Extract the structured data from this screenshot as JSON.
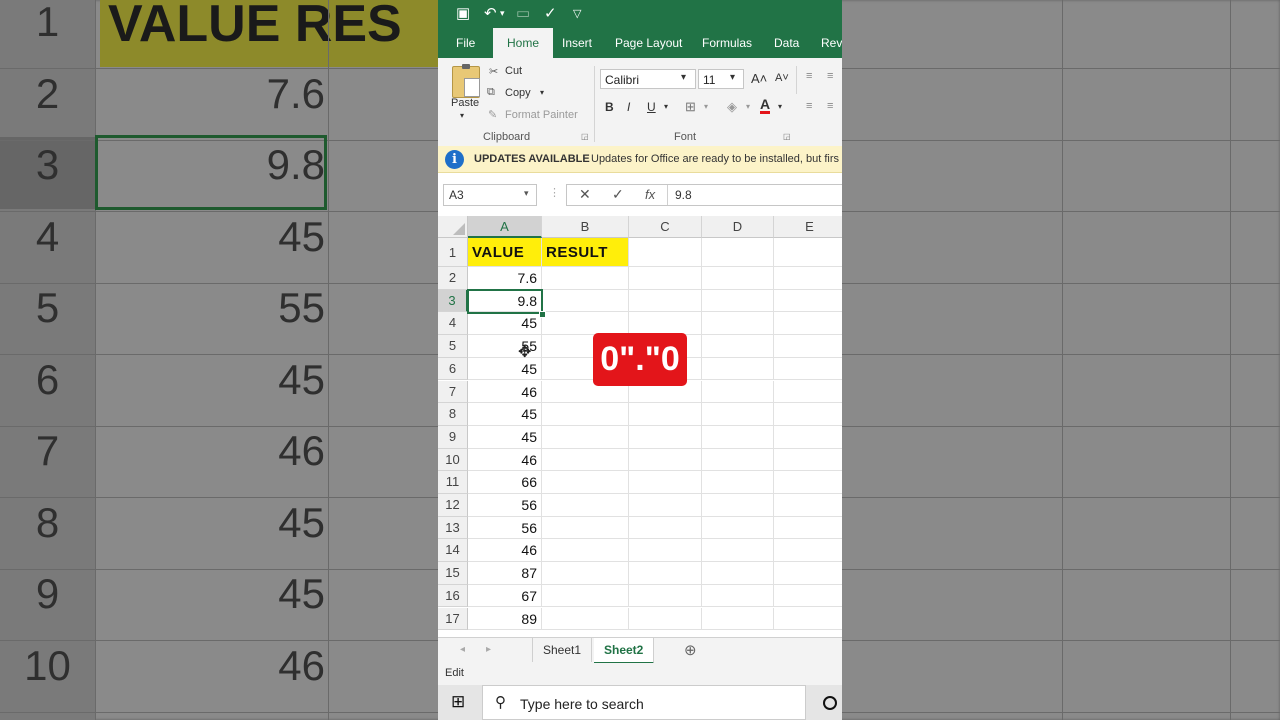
{
  "background": {
    "header_text": "VALUE RES",
    "rows": [
      {
        "num": "1"
      },
      {
        "num": "2",
        "val": "7.6"
      },
      {
        "num": "3",
        "val": "9.8"
      },
      {
        "num": "4",
        "val": "45"
      },
      {
        "num": "5",
        "val": "55"
      },
      {
        "num": "6",
        "val": "45"
      },
      {
        "num": "7",
        "val": "46"
      },
      {
        "num": "8",
        "val": "45"
      },
      {
        "num": "9",
        "val": "45"
      },
      {
        "num": "10",
        "val": "46"
      }
    ]
  },
  "ribbon": {
    "tabs": [
      "File",
      "Home",
      "Insert",
      "Page Layout",
      "Formulas",
      "Data",
      "Revi"
    ],
    "active_tab": "Home",
    "clipboard": {
      "paste": "Paste",
      "cut": "Cut",
      "copy": "Copy",
      "format_painter": "Format Painter",
      "group_label": "Clipboard"
    },
    "font": {
      "name": "Calibri",
      "size": "11",
      "bold": "B",
      "italic": "I",
      "underline": "U",
      "group_label": "Font"
    }
  },
  "banner": {
    "title": "UPDATES AVAILABLE",
    "message": "Updates for Office are ready to be installed, but firs"
  },
  "formula_bar": {
    "name_box": "A3",
    "fx": "fx",
    "value": "9.8"
  },
  "grid": {
    "columns": [
      "A",
      "B",
      "C",
      "D",
      "E"
    ],
    "header_cells": {
      "a1": "VALUE",
      "b1": "RESULT"
    },
    "rows": [
      {
        "num": "1",
        "a": ""
      },
      {
        "num": "2",
        "a": "7.6"
      },
      {
        "num": "3",
        "a": "9.8"
      },
      {
        "num": "4",
        "a": "45"
      },
      {
        "num": "5",
        "a": "55"
      },
      {
        "num": "6",
        "a": "45"
      },
      {
        "num": "7",
        "a": "46"
      },
      {
        "num": "8",
        "a": "45"
      },
      {
        "num": "9",
        "a": "45"
      },
      {
        "num": "10",
        "a": "46"
      },
      {
        "num": "11",
        "a": "66"
      },
      {
        "num": "12",
        "a": "56"
      },
      {
        "num": "13",
        "a": "56"
      },
      {
        "num": "14",
        "a": "46"
      },
      {
        "num": "15",
        "a": "87"
      },
      {
        "num": "16",
        "a": "67"
      },
      {
        "num": "17",
        "a": "89"
      }
    ],
    "active_cell": "A3"
  },
  "sheets": {
    "tabs": [
      "Sheet1",
      "Sheet2"
    ],
    "active": "Sheet2"
  },
  "status": {
    "mode": "Edit"
  },
  "taskbar": {
    "search_placeholder": "Type here to search"
  },
  "overlay": {
    "text": "0\".\"0"
  },
  "colors": {
    "excel_green": "#217346",
    "header_yellow": "#ffee0a",
    "overlay_red": "#e3151a"
  }
}
